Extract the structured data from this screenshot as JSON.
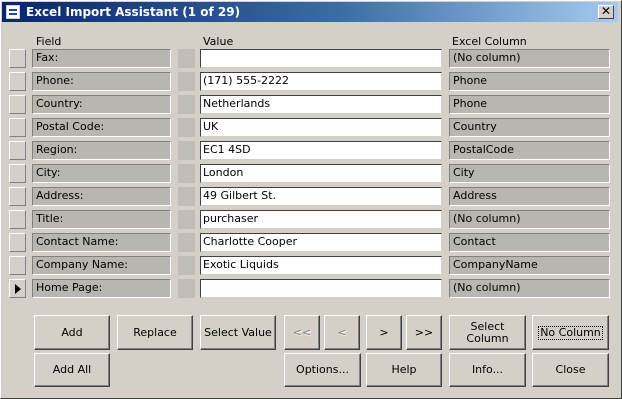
{
  "window": {
    "title": "Excel Import Assistant (1 of 29)",
    "close_glyph": "✕"
  },
  "headers": {
    "field": "Field",
    "value": "Value",
    "excel_column": "Excel Column"
  },
  "rows": [
    {
      "field": "Fax:",
      "value": "",
      "column": "(No column)",
      "current": false
    },
    {
      "field": "Phone:",
      "value": "(171) 555-2222",
      "column": "Phone",
      "current": false
    },
    {
      "field": "Country:",
      "value": "Netherlands",
      "column": "Phone",
      "current": false
    },
    {
      "field": "Postal Code:",
      "value": "UK",
      "column": "Country",
      "current": false
    },
    {
      "field": "Region:",
      "value": "EC1 4SD",
      "column": "PostalCode",
      "current": false
    },
    {
      "field": "City:",
      "value": "London",
      "column": "City",
      "current": false
    },
    {
      "field": "Address:",
      "value": "49 Gilbert St.",
      "column": "Address",
      "current": false
    },
    {
      "field": "Title:",
      "value": "purchaser",
      "column": "(No column)",
      "current": false
    },
    {
      "field": "Contact Name:",
      "value": "Charlotte Cooper",
      "column": "Contact",
      "current": false
    },
    {
      "field": "Company Name:",
      "value": "Exotic Liquids",
      "column": "CompanyName",
      "current": false
    },
    {
      "field": "Home Page:",
      "value": "",
      "column": "(No column)",
      "current": true
    }
  ],
  "buttons": {
    "add": "Add",
    "replace": "Replace",
    "select_value": "Select Value",
    "first": "<<",
    "prev": "<",
    "next": ">",
    "last": ">>",
    "select_column_line1": "Select",
    "select_column_line2": "Column",
    "no_column": "No Column",
    "add_all": "Add All",
    "options": "Options...",
    "help": "Help",
    "info": "Info...",
    "close": "Close"
  }
}
